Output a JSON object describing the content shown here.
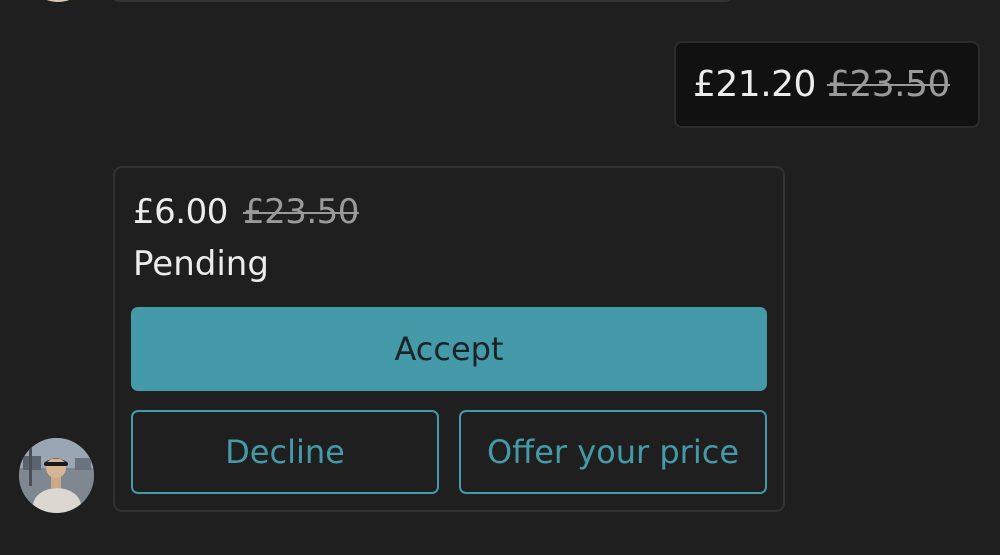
{
  "previous_message": {
    "avatar_icon": "user-avatar-icon"
  },
  "my_offer": {
    "price": "£21.20",
    "original_price": "£23.50"
  },
  "received_offer": {
    "price": "£6.00",
    "original_price": "£23.50",
    "status": "Pending",
    "accept_label": "Accept",
    "decline_label": "Decline",
    "counter_label": "Offer your price",
    "avatar_icon": "user-avatar-icon"
  },
  "colors": {
    "background": "#1f1f1f",
    "accent": "#449aa8",
    "text": "#ececec",
    "muted": "#9a9a9a"
  }
}
